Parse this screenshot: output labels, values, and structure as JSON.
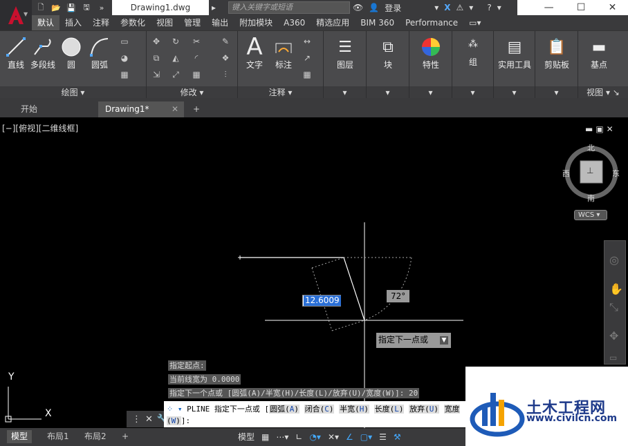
{
  "app": {
    "doc_title": "Drawing1.dwg"
  },
  "search": {
    "placeholder": "键入关键字或短语",
    "login": "登录"
  },
  "ribbon_tabs": [
    "默认",
    "插入",
    "注释",
    "参数化",
    "视图",
    "管理",
    "输出",
    "附加模块",
    "A360",
    "精选应用",
    "BIM 360",
    "Performance"
  ],
  "draw_panel": {
    "title": "绘图",
    "tools": [
      "直线",
      "多段线",
      "圆",
      "圆弧"
    ]
  },
  "modify_panel": {
    "title": "修改"
  },
  "annot_panel": {
    "title": "注释",
    "tools": [
      "文字",
      "标注"
    ]
  },
  "big_tools": [
    "图层",
    "块",
    "特性",
    "组",
    "实用工具",
    "剪贴板",
    "基点"
  ],
  "view_panel": {
    "title": "视图"
  },
  "doc_tabs": [
    "开始",
    "Drawing1*"
  ],
  "view_label": "[−][俯视][二维线框]",
  "viewcube": {
    "north": "北",
    "south": "南",
    "east": "东",
    "west": "西",
    "wcs": "WCS"
  },
  "dynamic_input": {
    "distance": "12.6009",
    "angle": "72°",
    "prompt": "指定下一点或"
  },
  "history": [
    "指定起点:",
    "当前线宽为 0.0000",
    "指定下一个点或 [圆弧(A)/半宽(H)/长度(L)/放弃(U)/宽度(W)]: 20"
  ],
  "cmd": {
    "prefix": "PLINE 指定下一点或 [",
    "options": [
      {
        "t": "圆弧",
        "k": "A"
      },
      {
        "t": "闭合",
        "k": "C"
      },
      {
        "t": "半宽",
        "k": "H"
      },
      {
        "t": "长度",
        "k": "L"
      },
      {
        "t": "放弃",
        "k": "U"
      },
      {
        "t": "宽度",
        "k": "W"
      }
    ],
    "suffix": "]:"
  },
  "layout_tabs": [
    "模型",
    "布局1",
    "布局2"
  ],
  "status": {
    "model": "模型"
  },
  "ucs": {
    "x": "X",
    "y": "Y"
  },
  "watermark": {
    "name": "土木工程网",
    "url": "www.civilcn.com"
  }
}
